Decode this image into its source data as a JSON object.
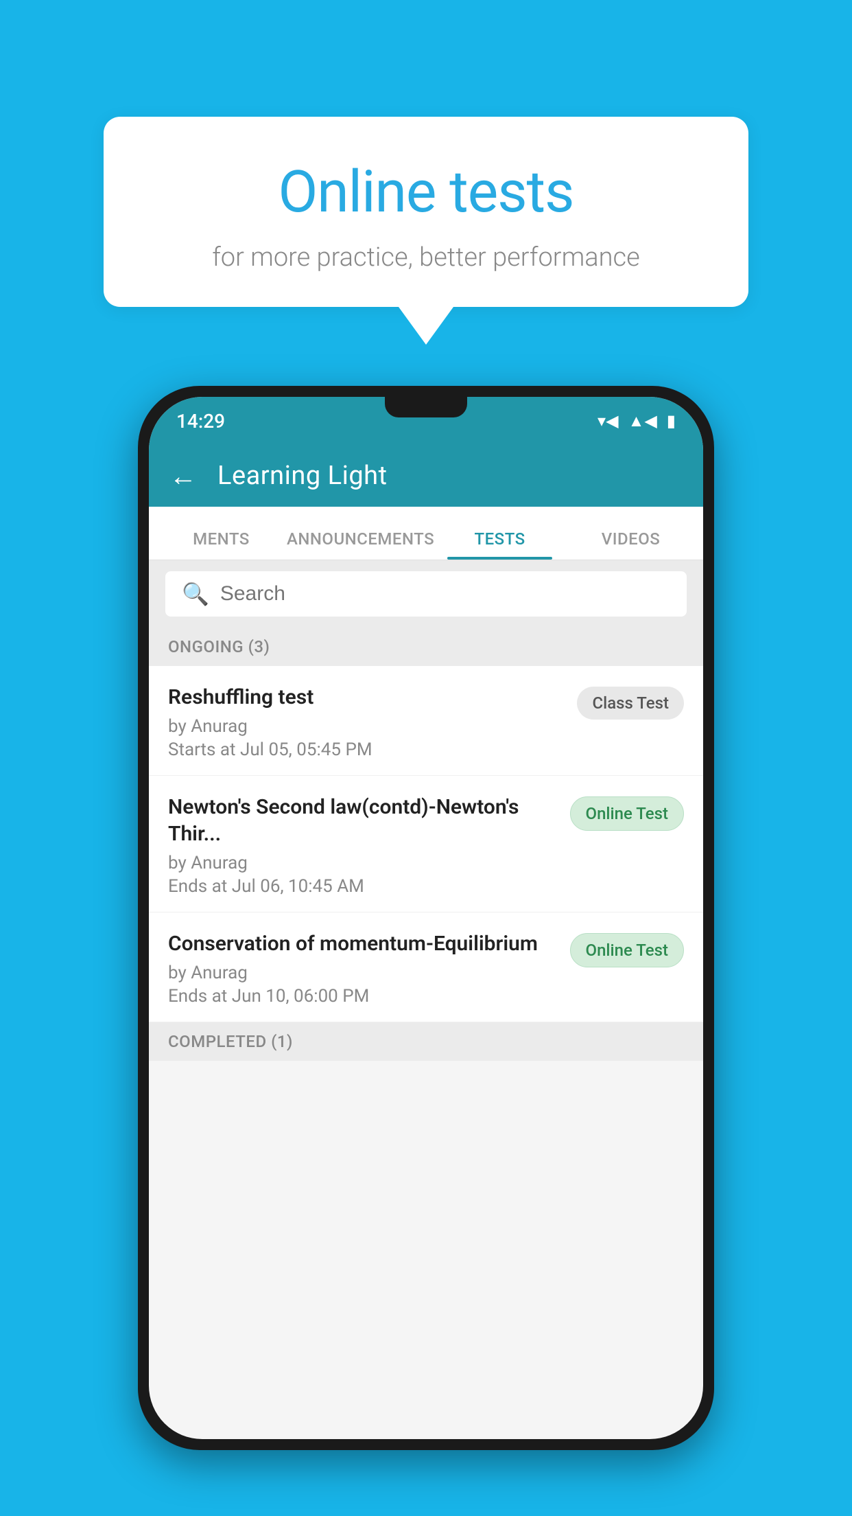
{
  "background": {
    "color": "#18B4E8"
  },
  "speech_bubble": {
    "title": "Online tests",
    "subtitle": "for more practice, better performance"
  },
  "phone": {
    "status_bar": {
      "time": "14:29",
      "icons": [
        "wifi",
        "signal",
        "battery"
      ]
    },
    "app_header": {
      "back_label": "←",
      "title": "Learning Light"
    },
    "tabs": [
      {
        "label": "MENTS",
        "active": false
      },
      {
        "label": "ANNOUNCEMENTS",
        "active": false
      },
      {
        "label": "TESTS",
        "active": true
      },
      {
        "label": "VIDEOS",
        "active": false
      }
    ],
    "search": {
      "placeholder": "Search"
    },
    "sections": [
      {
        "header": "ONGOING (3)",
        "items": [
          {
            "name": "Reshuffling test",
            "author": "by Anurag",
            "date": "Starts at  Jul 05, 05:45 PM",
            "badge": "Class Test",
            "badge_type": "class"
          },
          {
            "name": "Newton's Second law(contd)-Newton's Thir...",
            "author": "by Anurag",
            "date": "Ends at  Jul 06, 10:45 AM",
            "badge": "Online Test",
            "badge_type": "online"
          },
          {
            "name": "Conservation of momentum-Equilibrium",
            "author": "by Anurag",
            "date": "Ends at  Jun 10, 06:00 PM",
            "badge": "Online Test",
            "badge_type": "online"
          }
        ]
      }
    ],
    "completed_section": {
      "header": "COMPLETED (1)"
    }
  }
}
